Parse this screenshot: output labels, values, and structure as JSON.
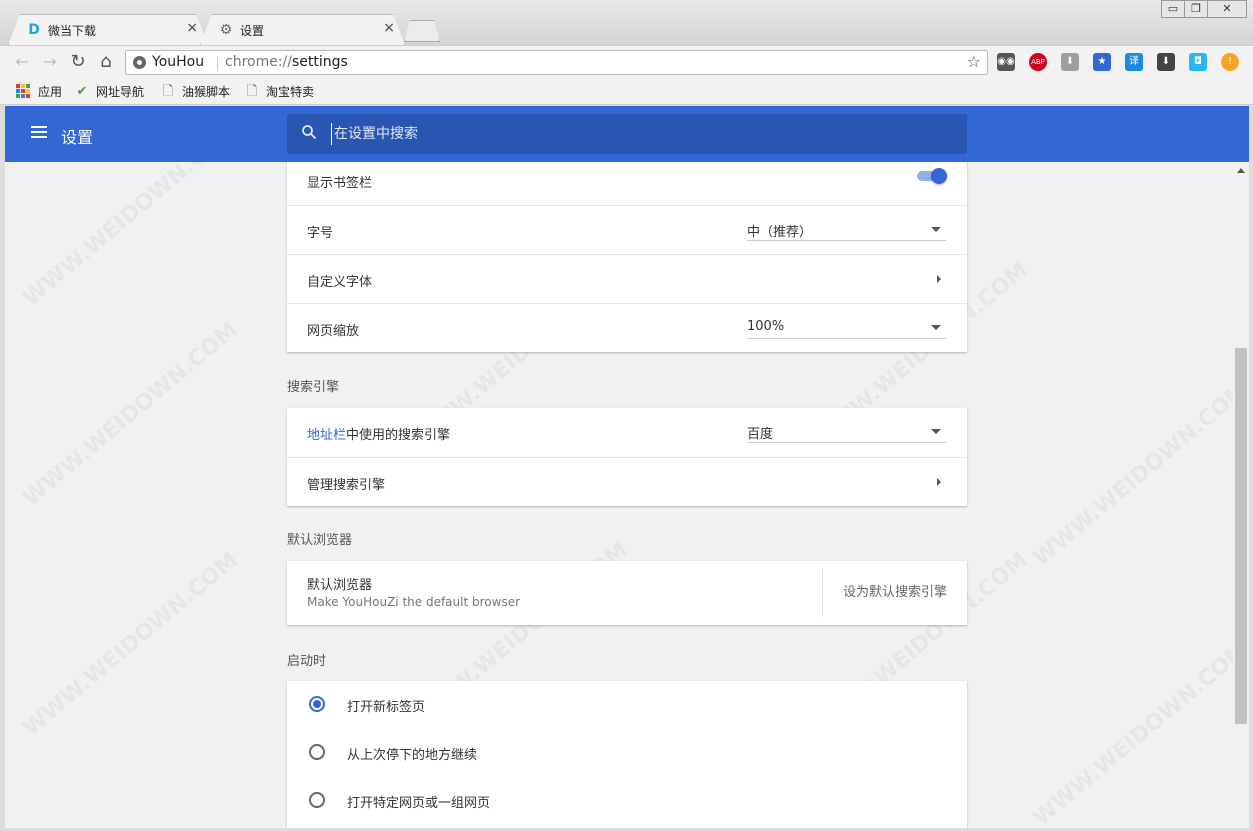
{
  "tabs": [
    {
      "title": "微当下载",
      "close": "×",
      "favicon": "D"
    },
    {
      "title": "设置",
      "close": "×",
      "favicon": "⚙"
    }
  ],
  "window_controls": {
    "minimize": "▭",
    "maximize": "❐",
    "close": "✕"
  },
  "toolbar": {
    "back": "←",
    "forward": "→",
    "reload": "↻",
    "home": "⌂",
    "site_name": "YouHou",
    "url_scheme": "chrome://",
    "url_path": "settings",
    "star": "☆",
    "extensions": [
      {
        "name": "tampermonkey-icon",
        "glyph": "◉◉",
        "color": "#555555"
      },
      {
        "name": "adblock-plus-icon",
        "glyph": "ABP",
        "color": "#d0021b"
      },
      {
        "name": "download-gray-icon",
        "glyph": "⬇",
        "color": "#9e9e9e"
      },
      {
        "name": "bookmark-manager-icon",
        "glyph": "★",
        "color": "#3367d6"
      },
      {
        "name": "translate-icon",
        "glyph": "译",
        "color": "#1e88e5"
      },
      {
        "name": "download-icon",
        "glyph": "⬇",
        "color": "#444444"
      },
      {
        "name": "screenshot-icon",
        "glyph": "◘",
        "color": "#29b6f6"
      },
      {
        "name": "alert-icon",
        "glyph": "!",
        "color": "#f5a623"
      }
    ]
  },
  "bookmarks": [
    {
      "label": "应用",
      "icon": "apps-grid-icon"
    },
    {
      "label": "网址导航",
      "icon": "hao-icon"
    },
    {
      "label": "油猴脚本",
      "icon": "page-icon"
    },
    {
      "label": "淘宝特卖",
      "icon": "page-icon"
    }
  ],
  "header": {
    "title": "设置",
    "search_placeholder": "在设置中搜索"
  },
  "appearance": {
    "show_bookmarks_bar": "显示书签栏",
    "show_bookmarks_bar_on": true,
    "font_size_label": "字号",
    "font_size_value": "中（推荐）",
    "custom_fonts": "自定义字体",
    "page_zoom_label": "网页缩放",
    "page_zoom_value": "100%"
  },
  "search_engine": {
    "section_title": "搜索引擎",
    "address_bar_link": "地址栏",
    "address_bar_rest": "中使用的搜索引擎",
    "engine_value": "百度",
    "manage": "管理搜索引擎"
  },
  "default_browser": {
    "section_title": "默认浏览器",
    "label": "默认浏览器",
    "sublabel": "Make YouHouZi the default browser",
    "action": "设为默认搜索引擎"
  },
  "startup": {
    "section_title": "启动时",
    "options": [
      {
        "label": "打开新标签页",
        "selected": true
      },
      {
        "label": "从上次停下的地方继续",
        "selected": false
      },
      {
        "label": "打开特定网页或一组网页",
        "selected": false
      }
    ]
  },
  "colors": {
    "accent": "#3367d6",
    "link": "#3367d6"
  }
}
